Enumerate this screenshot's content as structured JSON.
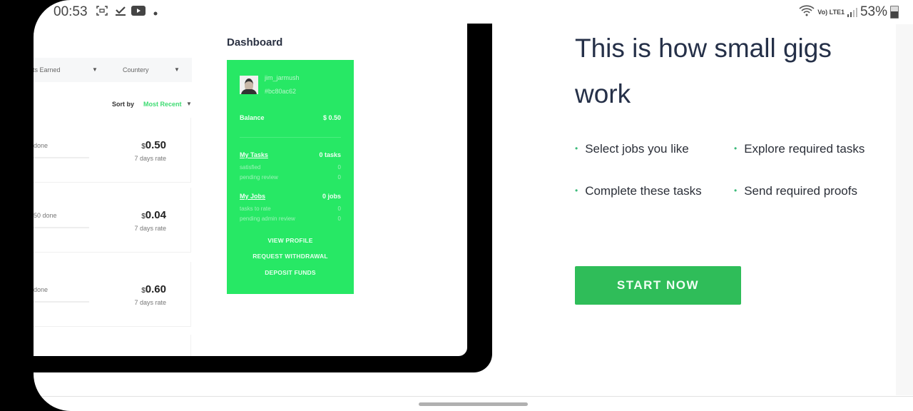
{
  "status_bar": {
    "time": "00:53",
    "left_icons": [
      "screenshot-icon",
      "download-done-icon",
      "youtube-icon",
      "dot-icon"
    ],
    "network_label": "Vo) LTE1",
    "battery_percent": "53%",
    "battery_level": 0.53
  },
  "tablet": {
    "filters": [
      {
        "label": "Points Earned",
        "visible_label": "ints Earned"
      },
      {
        "label": "Countery"
      }
    ],
    "sort": {
      "label": "Sort by",
      "value": "Most Recent"
    },
    "jobs": [
      {
        "done_text": "done",
        "currency": "$",
        "price": "0.50",
        "rate_label": "7 days rate"
      },
      {
        "done_text": "50 done",
        "currency": "$",
        "price": "0.04",
        "rate_label": "7 days rate"
      },
      {
        "done_text": "done",
        "currency": "$",
        "price": "0.60",
        "rate_label": "7 days rate"
      }
    ],
    "dashboard": {
      "title": "Dashboard",
      "username": "jim_jarmush",
      "user_hash": "#bc80ac62",
      "balance_label": "Balance",
      "balance_value": "$ 0.50",
      "tasks": {
        "label": "My Tasks",
        "value": "0 tasks",
        "rows": [
          {
            "label": "satisfied",
            "value": "0"
          },
          {
            "label": "pending review",
            "value": "0"
          }
        ]
      },
      "jobs": {
        "label": "My Jobs",
        "value": "0 jobs",
        "rows": [
          {
            "label": "tasks to rate",
            "value": "0"
          },
          {
            "label": "pending admin review",
            "value": "0"
          }
        ]
      },
      "actions": [
        "VIEW PROFILE",
        "REQUEST WITHDRAWAL",
        "DEPOSIT FUNDS"
      ],
      "accent": "#27e865"
    }
  },
  "marketing": {
    "headline": "This is how small gigs work",
    "bullets": [
      "Select jobs you like",
      "Explore required tasks",
      "Complete these tasks",
      "Send required proofs"
    ],
    "cta_label": "START NOW",
    "cta_color": "#2fbd59"
  }
}
